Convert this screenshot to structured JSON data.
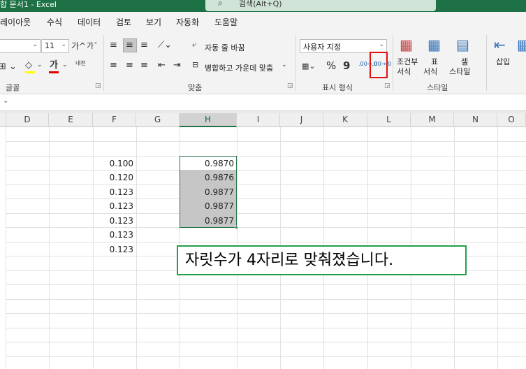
{
  "titlebar": {
    "title": "합 문서1 - Excel",
    "search_placeholder": "검색(Alt+Q)"
  },
  "menu": {
    "tabs": [
      "레이아웃",
      "수식",
      "데이터",
      "검토",
      "보기",
      "자동화",
      "도움말"
    ]
  },
  "ribbon": {
    "font": {
      "size": "11",
      "grow": "가^",
      "shrink": "가ˇ",
      "font_color_glyph": "가",
      "phonetic": "내천",
      "group_label": "글꼴"
    },
    "alignment": {
      "wrap_text": "자동 줄 바꿈",
      "merge_center": "병합하고 가운데 맞춤",
      "group_label": "맞춤"
    },
    "number": {
      "format_value": "사용자 지정",
      "percent": "%",
      "comma": "9",
      "group_label": "표시 형식",
      "increase_decimal": ".00→.0",
      "decrease_decimal": ".00→.0"
    },
    "styles": {
      "conditional": [
        "조건부",
        "서식"
      ],
      "format_table": [
        "표",
        "서식"
      ],
      "cell_styles": [
        "셀",
        "스타일"
      ],
      "group_label": "스타일"
    },
    "cells": {
      "insert": "삽입"
    }
  },
  "grid": {
    "columns": [
      "D",
      "E",
      "F",
      "G",
      "H",
      "I",
      "J",
      "K",
      "L",
      "M",
      "N",
      "O"
    ],
    "selected_column": "H",
    "column_f": [
      "0.100",
      "0.120",
      "0.123",
      "0.123",
      "0.123",
      "0.123",
      "0.123"
    ],
    "column_h": [
      "0.9870",
      "0.9876",
      "0.9877",
      "0.9877",
      "0.9877"
    ]
  },
  "callout": {
    "text": "자릿수가 4자리로 맞춰졌습니다."
  },
  "colors": {
    "excel_green": "#1e7145",
    "highlight_red": "#e01010",
    "callout_border": "#22a04b"
  }
}
